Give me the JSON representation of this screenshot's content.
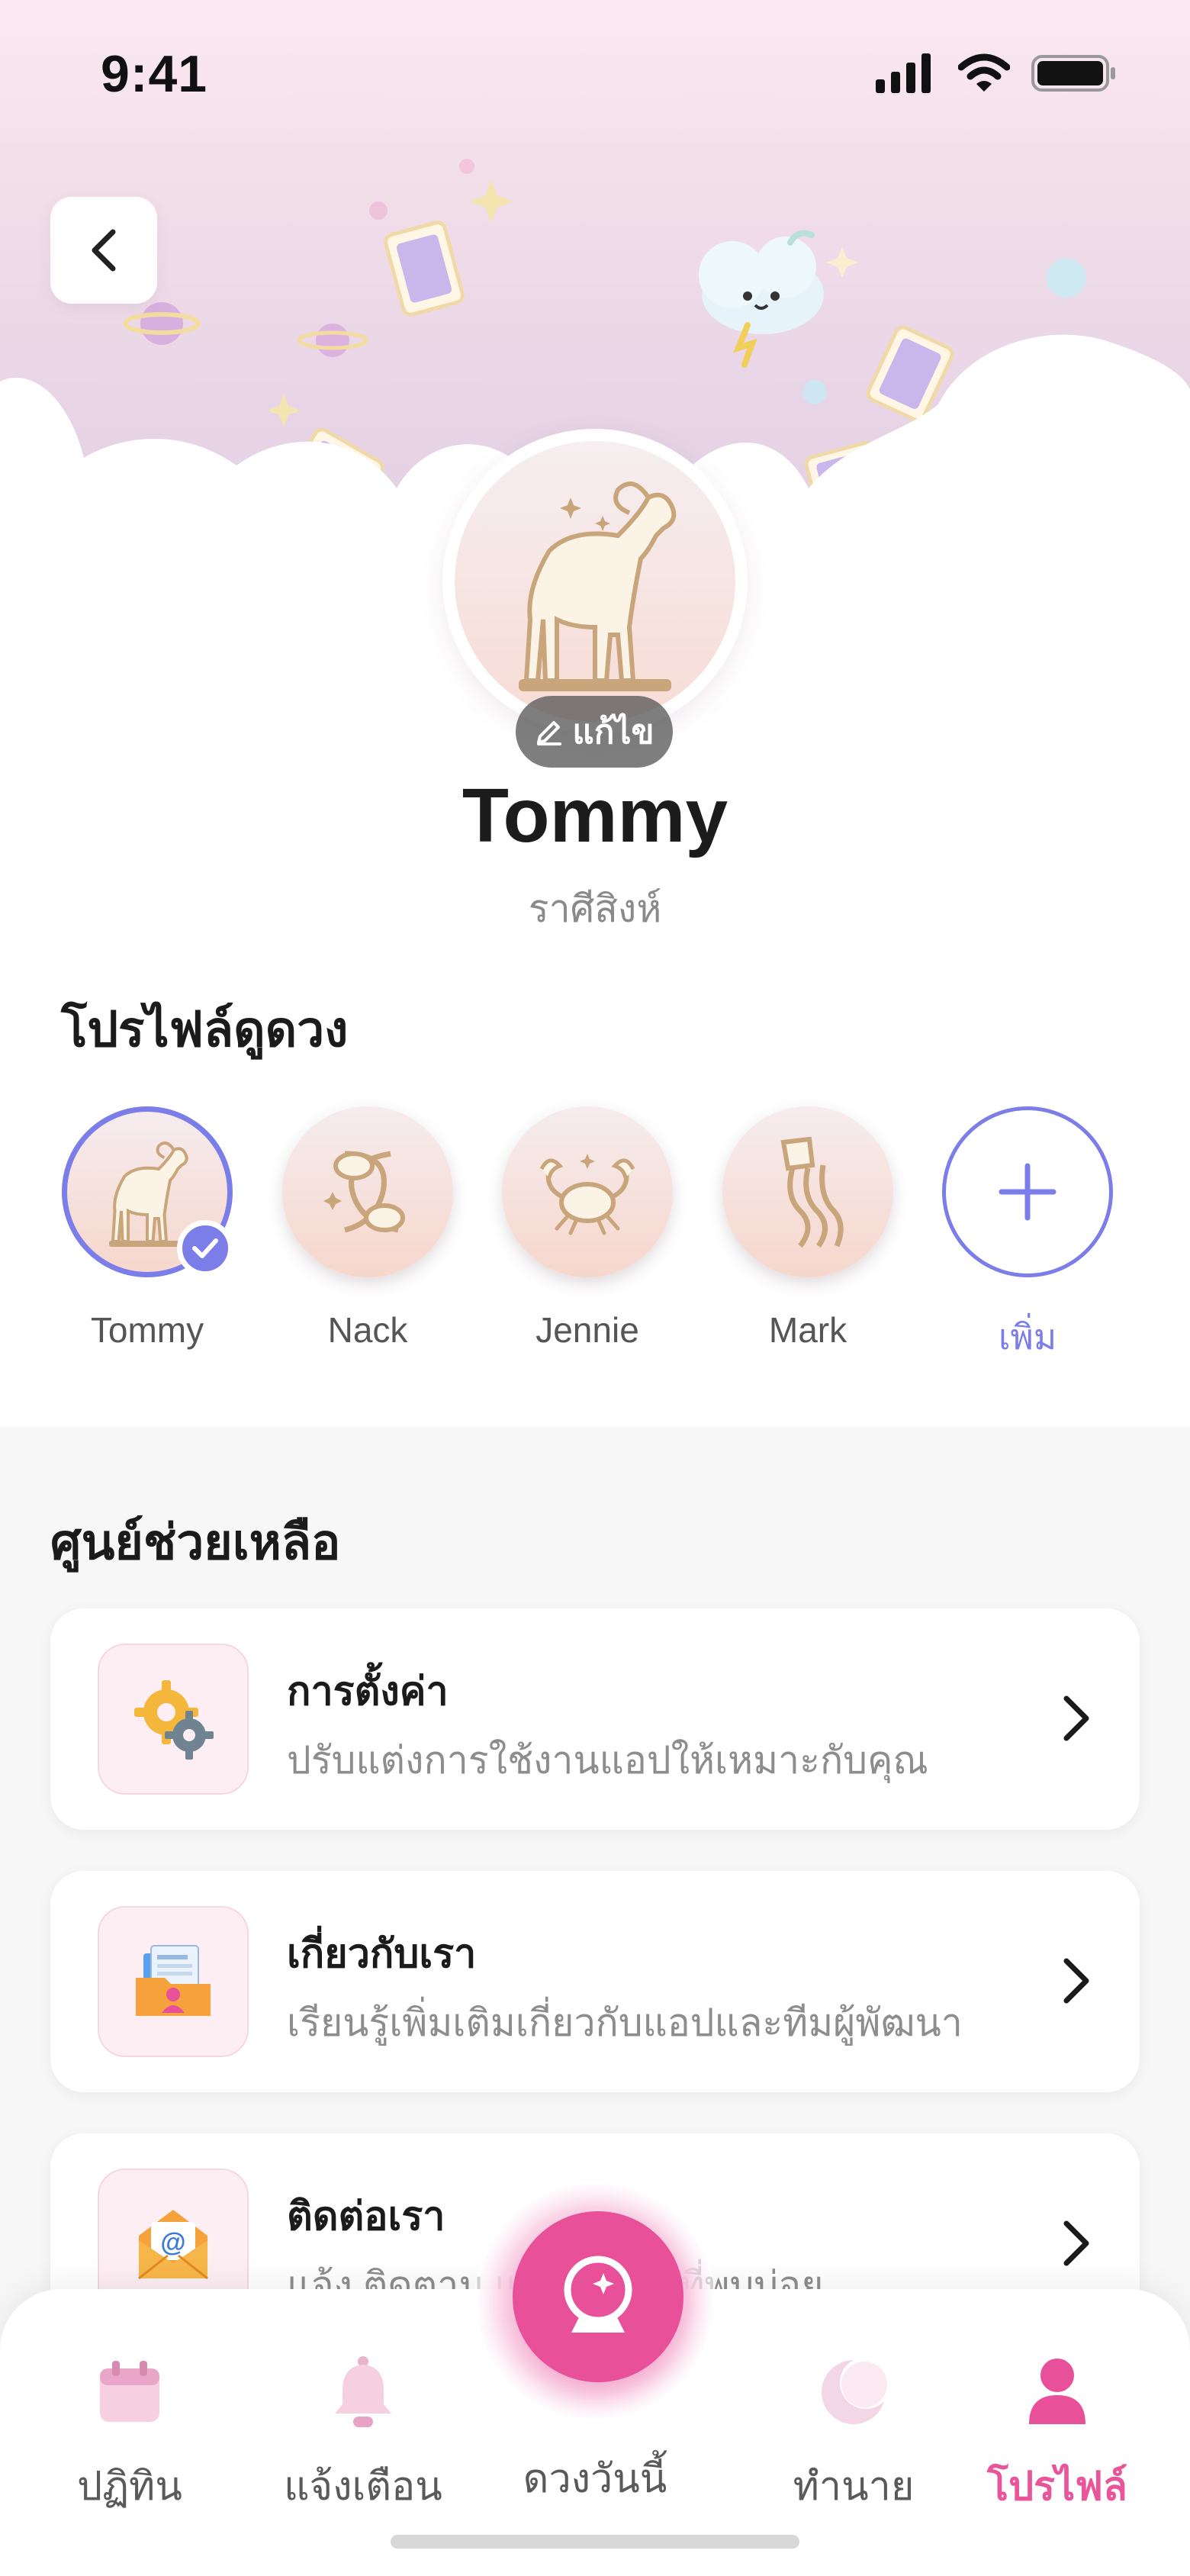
{
  "status_bar": {
    "time": "9:41"
  },
  "profile": {
    "name": "Tommy",
    "zodiac": "ราศีสิงห์",
    "edit_label": "แก้ไข"
  },
  "fortune_profiles": {
    "title": "โปรไฟล์ดูดวง",
    "items": [
      {
        "name": "Tommy",
        "icon": "aries-goat-icon",
        "selected": true
      },
      {
        "name": "Nack",
        "icon": "pisces-fish-icon",
        "selected": false
      },
      {
        "name": "Jennie",
        "icon": "cancer-crab-icon",
        "selected": false
      },
      {
        "name": "Mark",
        "icon": "aquarius-water-bearer-icon",
        "selected": false
      }
    ],
    "add_label": "เพิ่ม"
  },
  "help_center": {
    "title": "ศูนย์ช่วยเหลือ",
    "items": [
      {
        "title": "การตั้งค่า",
        "description": "ปรับแต่งการใช้งานแอปให้เหมาะกับคุณ",
        "icon": "settings-gears-icon"
      },
      {
        "title": "เกี่ยวกับเรา",
        "description": "เรียนรู้เพิ่มเติมเกี่ยวกับแอปและทีมผู้พัฒนา",
        "icon": "about-folder-icon"
      },
      {
        "title": "ติดต่อเรา",
        "description": "แจ้ง ติดตาม และคำถามที่พบบ่อย",
        "icon": "contact-mail-icon"
      }
    ]
  },
  "bottom_nav": {
    "items": [
      {
        "label": "ปฏิทิน",
        "icon": "calendar-icon",
        "active": false
      },
      {
        "label": "แจ้งเตือน",
        "icon": "bell-icon",
        "active": false
      },
      {
        "label": "ดวงวันนี้",
        "icon": "crystal-ball-icon",
        "active": false
      },
      {
        "label": "ทำนาย",
        "icon": "moon-icon",
        "active": false
      },
      {
        "label": "โปรไฟล์",
        "icon": "person-icon",
        "active": true
      }
    ]
  },
  "colors": {
    "accent_purple": "#7b7de8",
    "accent_pink": "#e8509a",
    "hero_pink": "#f3dfe9"
  }
}
